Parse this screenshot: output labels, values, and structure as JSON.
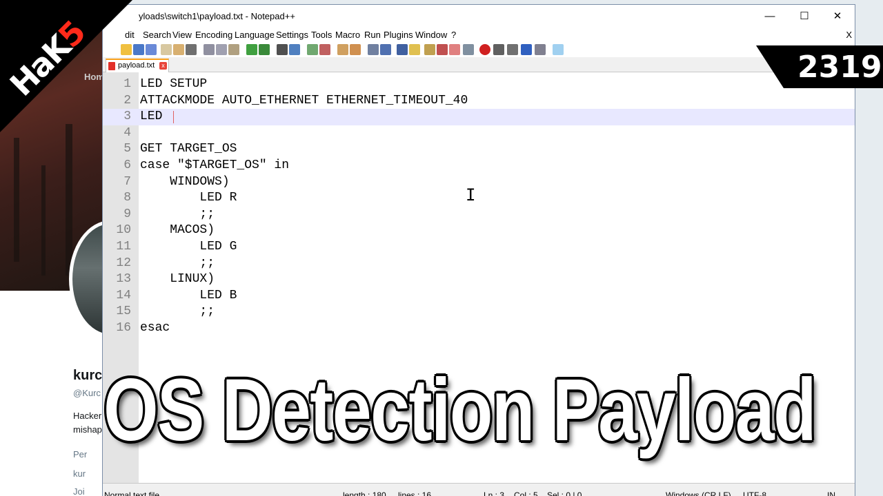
{
  "window": {
    "title": "yloads\\switch1\\payload.txt - Notepad++",
    "minimize": "—",
    "maximize": "☐",
    "close": "✕"
  },
  "menu": {
    "items": [
      "dit",
      "Search",
      "View",
      "Encoding",
      "Language",
      "Settings",
      "Tools",
      "Macro",
      "Run",
      "Plugins",
      "Window",
      "?"
    ],
    "close": "X"
  },
  "tab": {
    "label": "payload.txt",
    "close": "x"
  },
  "editor": {
    "current_line": 3,
    "lines": [
      {
        "n": "1",
        "text": "LED SETUP"
      },
      {
        "n": "2",
        "text": "ATTACKMODE AUTO_ETHERNET ETHERNET_TIMEOUT_40"
      },
      {
        "n": "3",
        "text": "LED "
      },
      {
        "n": "4",
        "text": ""
      },
      {
        "n": "5",
        "text": "GET TARGET_OS"
      },
      {
        "n": "6",
        "text": "case \"$TARGET_OS\" in"
      },
      {
        "n": "7",
        "text": "    WINDOWS)"
      },
      {
        "n": "8",
        "text": "        LED R"
      },
      {
        "n": "9",
        "text": "        ;;"
      },
      {
        "n": "10",
        "text": "    MACOS)"
      },
      {
        "n": "11",
        "text": "        LED G"
      },
      {
        "n": "12",
        "text": "        ;;"
      },
      {
        "n": "13",
        "text": "    LINUX)"
      },
      {
        "n": "14",
        "text": "        LED B"
      },
      {
        "n": "15",
        "text": "        ;;"
      },
      {
        "n": "16",
        "text": "esac"
      }
    ]
  },
  "status": {
    "file_type": "Normal text file",
    "length": "length : 180",
    "lines": "lines : 16",
    "ln": "Ln : 3",
    "col": "Col : 5",
    "sel": "Sel : 0 | 0",
    "eol": "Windows (CR LF)",
    "encoding": "UTF-8",
    "mode": "IN"
  },
  "overlay": {
    "title": "OS Detection Payload",
    "episode": "2319",
    "logo_a": "HaK",
    "logo_b": "5"
  },
  "background": {
    "name": "kurc",
    "handle": "@Kurc",
    "bio1": "Hacker",
    "bio2": "mishap",
    "location": "Per",
    "link": "kur",
    "joined": "Joi",
    "home": "Hom"
  },
  "colors": {
    "accent_tab": "#f9a01b",
    "current_line": "#e8e8ff",
    "gutter": "#e4e4e4",
    "logo_red": "#ff2a1a"
  }
}
